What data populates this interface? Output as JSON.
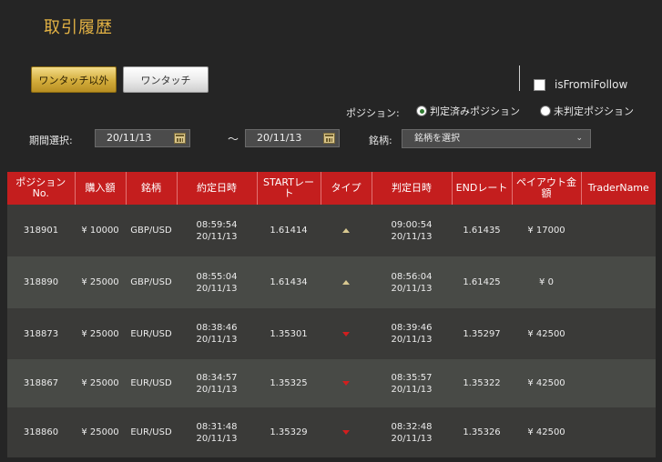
{
  "page": {
    "title": "取引履歴"
  },
  "tabs": {
    "active": "ワンタッチ以外",
    "inactive": "ワンタッチ"
  },
  "follow": {
    "label": "isFromiFollow",
    "checked": false
  },
  "position": {
    "label": "ポジション:",
    "options": [
      "判定済みポジション",
      "未判定ポジション"
    ],
    "selected": "判定済みポジション"
  },
  "filters": {
    "period_label": "期間選択:",
    "date_from": "20/11/13",
    "separator": "～",
    "date_to": "20/11/13",
    "symbol_label": "銘柄:",
    "symbol_value": "銘柄を選択"
  },
  "table": {
    "headers": [
      "ポジション\nNo.",
      "購入額",
      "銘柄",
      "約定日時",
      "STARTレー\nト",
      "タイプ",
      "判定日時",
      "ENDレート",
      "ペイアウト金\n額",
      "TraderName"
    ],
    "rows": [
      {
        "no": "318901",
        "amount": "¥ 10000",
        "symbol": "GBP/USD",
        "exec_time": "08:59:54",
        "exec_date": "20/11/13",
        "start": "1.61414",
        "type": "up",
        "judge_time": "09:00:54",
        "judge_date": "20/11/13",
        "end": "1.61435",
        "payout": "¥ 17000",
        "trader": ""
      },
      {
        "no": "318890",
        "amount": "¥ 25000",
        "symbol": "GBP/USD",
        "exec_time": "08:55:04",
        "exec_date": "20/11/13",
        "start": "1.61434",
        "type": "up",
        "judge_time": "08:56:04",
        "judge_date": "20/11/13",
        "end": "1.61425",
        "payout": "¥ 0",
        "trader": ""
      },
      {
        "no": "318873",
        "amount": "¥ 25000",
        "symbol": "EUR/USD",
        "exec_time": "08:38:46",
        "exec_date": "20/11/13",
        "start": "1.35301",
        "type": "down",
        "judge_time": "08:39:46",
        "judge_date": "20/11/13",
        "end": "1.35297",
        "payout": "¥ 42500",
        "trader": ""
      },
      {
        "no": "318867",
        "amount": "¥ 25000",
        "symbol": "EUR/USD",
        "exec_time": "08:34:57",
        "exec_date": "20/11/13",
        "start": "1.35325",
        "type": "down",
        "judge_time": "08:35:57",
        "judge_date": "20/11/13",
        "end": "1.35322",
        "payout": "¥ 42500",
        "trader": ""
      },
      {
        "no": "318860",
        "amount": "¥ 25000",
        "symbol": "EUR/USD",
        "exec_time": "08:31:48",
        "exec_date": "20/11/13",
        "start": "1.35329",
        "type": "down",
        "judge_time": "08:32:48",
        "judge_date": "20/11/13",
        "end": "1.35326",
        "payout": "¥ 42500",
        "trader": ""
      }
    ]
  },
  "colors": {
    "title": "#e3b244",
    "header_bg": "#c41e1e",
    "up": "#d8c890",
    "down": "#d11e1e"
  }
}
